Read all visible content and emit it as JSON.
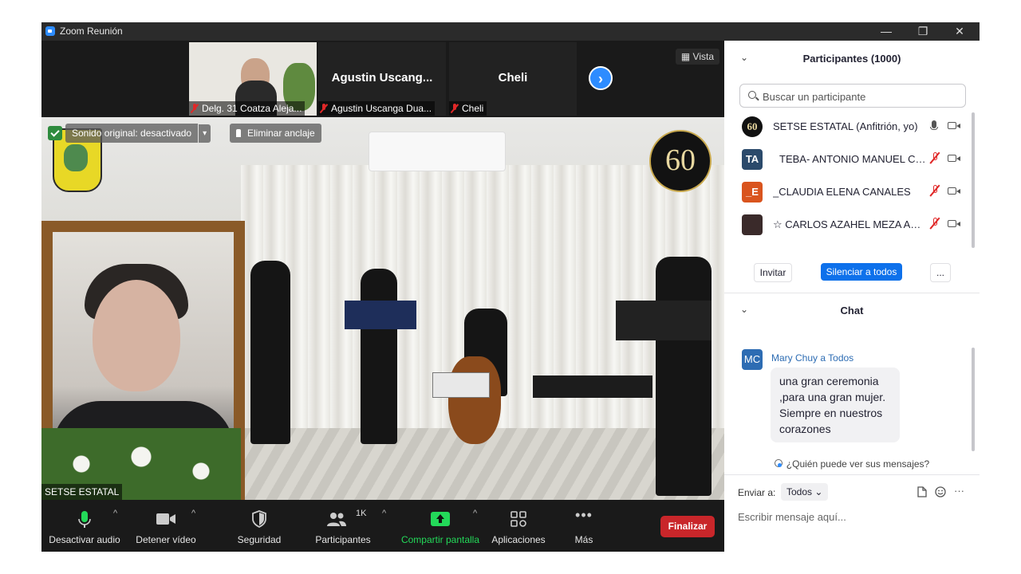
{
  "window": {
    "title": "Zoom Reunión"
  },
  "filmstrip": {
    "tiles": [
      {
        "display": "",
        "label": "Delg. 31 Coatza Aleja..."
      },
      {
        "display": "Agustin  Uscang...",
        "label": "Agustin Uscanga Dua..."
      },
      {
        "display": "Cheli",
        "label": "Cheli"
      }
    ],
    "view_label": "Vista"
  },
  "video": {
    "sound_label": "Sonido original: desactivado",
    "unpin_label": "Eliminar anclaje",
    "badge_text": "60",
    "speaker_name": "SETSE ESTATAL"
  },
  "toolbar": {
    "mute_label": "Desactivar audio",
    "video_label": "Detener vídeo",
    "security_label": "Seguridad",
    "participants_label": "Participantes",
    "participants_count": "1K",
    "share_label": "Compartir pantalla",
    "apps_label": "Aplicaciones",
    "more_label": "Más",
    "end_label": "Finalizar"
  },
  "participants": {
    "title": "Participantes (1000)",
    "search_placeholder": "Buscar un participante",
    "list": [
      {
        "avatar": "60",
        "name": "SETSE ESTATAL (Anfitrión, yo)",
        "muted": false,
        "avatar_color": "#111111"
      },
      {
        "avatar": "TA",
        "name": "TEBA- ANTONIO MANUEL CO...",
        "muted": true,
        "avatar_color": "#2b4a6b"
      },
      {
        "avatar": "_E",
        "name": "_CLAUDIA ELENA CANALES",
        "muted": true,
        "avatar_color": "#d9541e"
      },
      {
        "avatar": "",
        "name": "☆ CARLOS AZAHEL MEZA AGU...",
        "muted": true,
        "avatar_color": "#3a2a2a"
      }
    ],
    "invite_label": "Invitar",
    "mute_all_label": "Silenciar a todos",
    "more_label": "..."
  },
  "chat": {
    "title": "Chat",
    "messages": [
      {
        "avatar": "MC",
        "sender": "Mary Chuy a Todos",
        "lines": [
          ",para una gran mujer.",
          "Siempre en nuestros",
          "corazones"
        ],
        "first_line": "una gran ceremonia"
      }
    ],
    "who_can_see": "¿Quién puede ver sus mensajes?",
    "send_to_label": "Enviar a:",
    "recipient": "Todos",
    "input_placeholder": "Escribir mensaje aquí..."
  },
  "colors": {
    "accent": "#2d8cff",
    "end": "#c9262a",
    "share": "#23d959",
    "muted": "#e02828"
  }
}
